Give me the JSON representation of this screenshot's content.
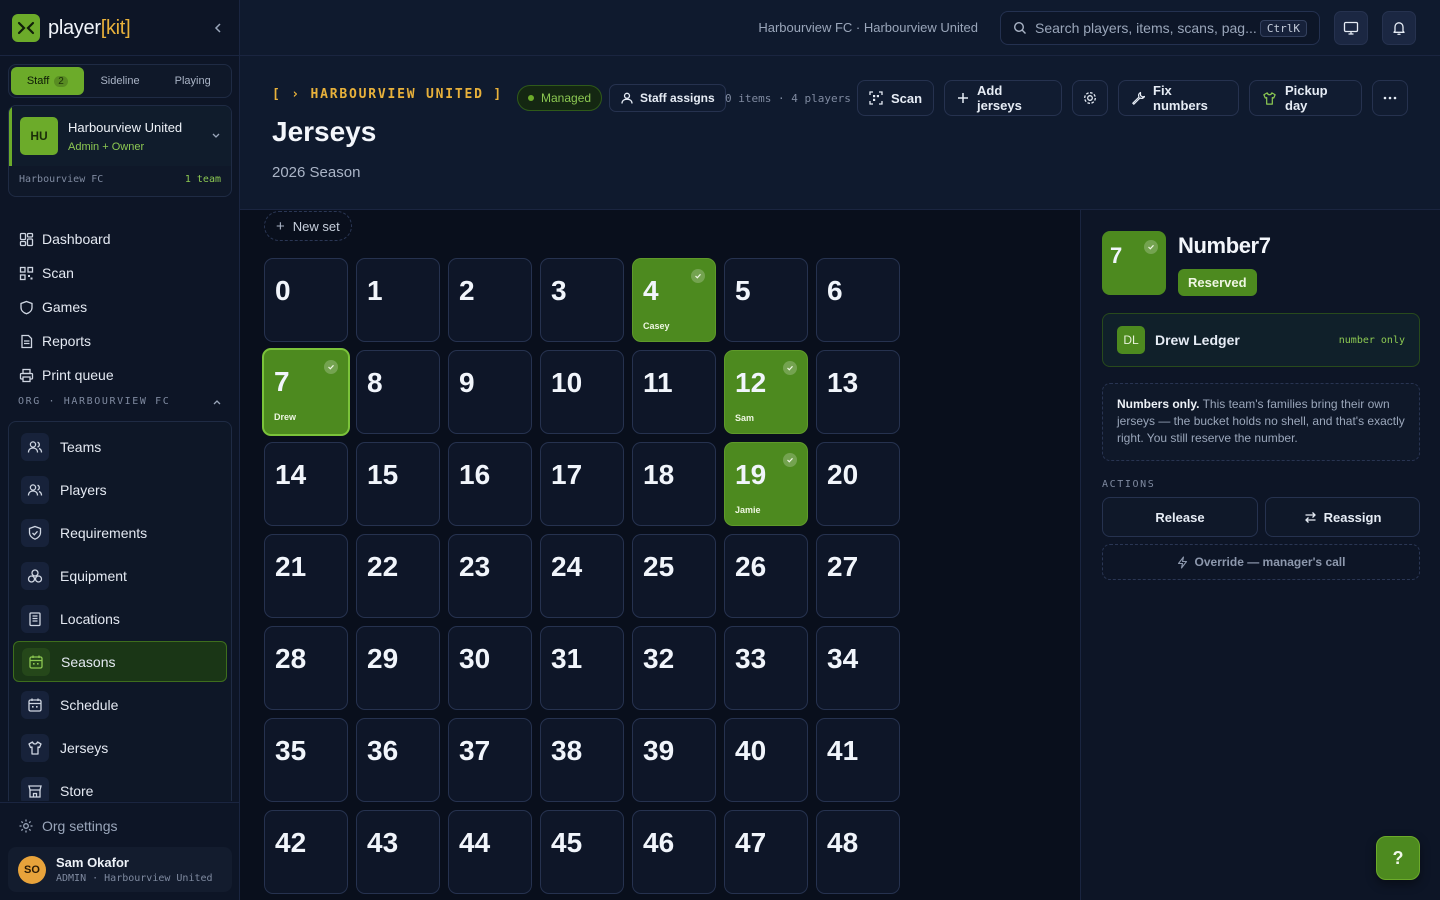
{
  "app": {
    "logo_prefix": "player",
    "logo_bracket_open": "[",
    "logo_kit": "kit",
    "logo_bracket_close": "]"
  },
  "mode_tabs": [
    {
      "label": "Staff",
      "count": "2",
      "active": true
    },
    {
      "label": "Sideline",
      "active": false
    },
    {
      "label": "Playing",
      "active": false
    }
  ],
  "team_card": {
    "avatar": "HU",
    "name": "Harbourview United",
    "role": "Admin + Owner",
    "org": "Harbourview FC",
    "team_count": "1 team"
  },
  "nav_main": [
    {
      "label": "Dashboard",
      "icon": "dashboard-icon"
    },
    {
      "label": "Scan",
      "icon": "qr-scan-icon"
    },
    {
      "label": "Games",
      "icon": "shield-icon"
    },
    {
      "label": "Reports",
      "icon": "document-icon"
    },
    {
      "label": "Print queue",
      "icon": "printer-icon"
    }
  ],
  "org_section_label": "ORG · HARBOURVIEW FC",
  "org_nav": [
    {
      "label": "Teams",
      "icon": "users-icon"
    },
    {
      "label": "Players",
      "icon": "users-icon"
    },
    {
      "label": "Requirements",
      "icon": "shield-check-icon"
    },
    {
      "label": "Equipment",
      "icon": "boxes-icon"
    },
    {
      "label": "Locations",
      "icon": "building-icon"
    },
    {
      "label": "Seasons",
      "icon": "calendar-icon",
      "active": true
    },
    {
      "label": "Schedule",
      "icon": "calendar-icon"
    },
    {
      "label": "Jerseys",
      "icon": "shirt-icon"
    },
    {
      "label": "Store",
      "icon": "store-icon"
    }
  ],
  "org_settings_label": "Org settings",
  "user": {
    "initials": "SO",
    "name": "Sam Okafor",
    "role": "ADMIN · Harbourview United"
  },
  "topbar": {
    "breadcrumb": "Harbourview FC · Harbourview United",
    "search_placeholder": "Search players, items, scans, pag...",
    "search_shortcut": "CtrlK"
  },
  "header": {
    "eyebrow": "[ › HARBOURVIEW UNITED ]",
    "title": "Jerseys",
    "subtitle": "2026 Season",
    "managed_label": "Managed",
    "staff_assigns_label": "Staff assigns",
    "items_meta": "0 items · 4 players",
    "scan_label": "Scan",
    "add_jerseys_label": "Add jerseys",
    "fix_numbers_label": "Fix numbers",
    "pickup_day_label": "Pickup day"
  },
  "grid": {
    "new_set_label": "New set",
    "numbers": [
      "0",
      "1",
      "2",
      "3",
      "4",
      "5",
      "6",
      "7",
      "8",
      "9",
      "10",
      "11",
      "12",
      "13",
      "14",
      "15",
      "16",
      "17",
      "18",
      "19",
      "20",
      "21",
      "22",
      "23",
      "24",
      "25",
      "26",
      "27",
      "28",
      "29",
      "30",
      "31",
      "32",
      "33",
      "34",
      "35",
      "36",
      "37",
      "38",
      "39",
      "40",
      "41",
      "42",
      "43",
      "44",
      "45",
      "46",
      "47",
      "48"
    ],
    "taken": {
      "4": "Casey",
      "7": "Drew",
      "12": "Sam",
      "19": "Jamie"
    },
    "selected": "7"
  },
  "detail": {
    "number": "7",
    "title": "Number7",
    "status": "Reserved",
    "holder_initials": "DL",
    "holder_name": "Drew Ledger",
    "holder_tag": "number only",
    "note_bold": "Numbers only.",
    "note_text": " This team's families bring their own jerseys — the bucket holds no shell, and that's exactly right. You still reserve the number.",
    "actions_label": "ACTIONS",
    "release_label": "Release",
    "reassign_label": "Reassign",
    "override_label": "Override — manager's call"
  },
  "help_label": "?",
  "colors": {
    "accent_green": "#6cab2a",
    "taken_green": "#4d8a1f",
    "brand_gold": "#e8b13b",
    "background": "#0b1220"
  }
}
